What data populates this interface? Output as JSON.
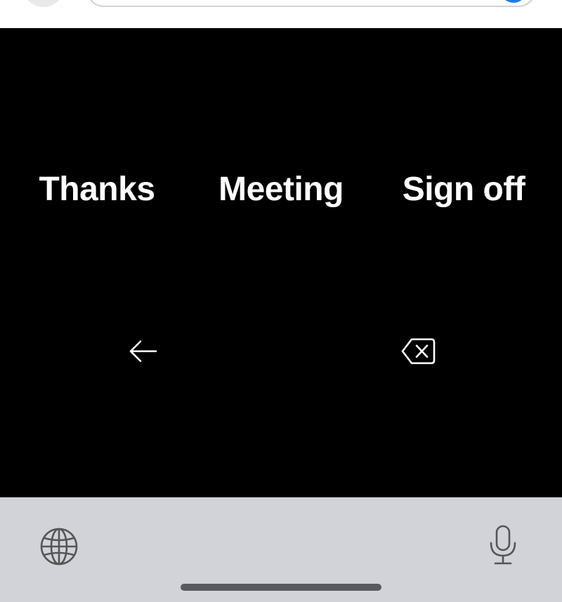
{
  "suggestions": [
    {
      "label": "Thanks"
    },
    {
      "label": "Meeting"
    },
    {
      "label": "Sign off"
    }
  ],
  "actions": {
    "back_icon": "arrow-left-icon",
    "delete_icon": "backspace-icon"
  },
  "keyboard": {
    "globe_icon": "globe-icon",
    "mic_icon": "microphone-icon"
  },
  "colors": {
    "panel_background": "#000000",
    "keyboard_background": "#d1d3d9",
    "send_accent": "#1f7af2",
    "text": "#ffffff",
    "keyboard_icon": "#555555"
  }
}
